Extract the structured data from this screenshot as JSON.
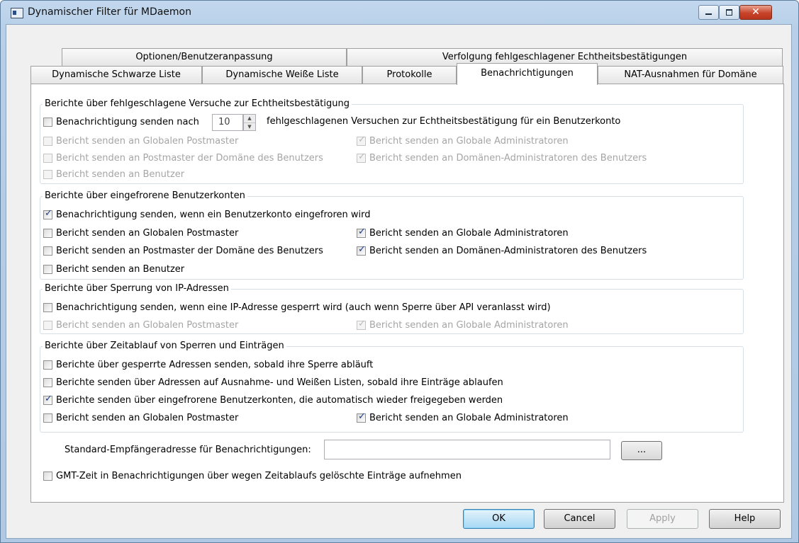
{
  "window": {
    "title": "Dynamischer Filter für MDaemon",
    "close_glyph": "✕"
  },
  "tabs": {
    "row1": [
      "Optionen/Benutzeranpassung",
      "Verfolgung fehlgeschlagener Echtheitsbestätigungen"
    ],
    "row2": [
      "Dynamische Schwarze Liste",
      "Dynamische Weiße Liste",
      "Protokolle",
      "Benachrichtigungen",
      "NAT-Ausnahmen für Domäne"
    ],
    "active": "Benachrichtigungen"
  },
  "groups": {
    "failed_auth": {
      "legend": "Berichte über fehlgeschlagene Versuche zur Echtheitsbestätigung",
      "notify_after_label": "Benachrichtigung senden nach",
      "notify_after_value": "10",
      "notify_after_suffix": "fehlgeschlagenen Versuchen zur Echtheitsbestätigung für ein Benutzerkonto",
      "report_global_postmaster": "Bericht senden an Globalen Postmaster",
      "report_global_admins": "Bericht senden an Globale Administratoren",
      "report_domain_postmaster": "Bericht senden an Postmaster der Domäne des Benutzers",
      "report_domain_admins": "Bericht senden an Domänen-Administratoren des Benutzers",
      "report_user": "Bericht senden an Benutzer"
    },
    "frozen": {
      "legend": "Berichte über eingefrorene Benutzerkonten",
      "notify_label": "Benachrichtigung senden, wenn ein Benutzerkonto eingefroren wird",
      "report_global_postmaster": "Bericht senden an Globalen Postmaster",
      "report_global_admins": "Bericht senden an Globale Administratoren",
      "report_domain_postmaster": "Bericht senden an Postmaster der Domäne des Benutzers",
      "report_domain_admins": "Bericht senden an Domänen-Administratoren des Benutzers",
      "report_user": "Bericht senden an Benutzer"
    },
    "ip_block": {
      "legend": "Berichte über Sperrung von IP-Adressen",
      "notify_label": "Benachrichtigung senden, wenn eine IP-Adresse gesperrt wird (auch wenn Sperre über API veranlasst wird)",
      "report_global_postmaster": "Bericht senden an Globalen Postmaster",
      "report_global_admins": "Bericht senden an Globale Administratoren"
    },
    "expiry": {
      "legend": "Berichte über Zeitablauf von Sperren und Einträgen",
      "blocked_expire": "Berichte über gesperrte Adressen senden, sobald ihre Sperre abläuft",
      "lists_expire": "Berichte senden über Adressen auf Ausnahme- und Weißen Listen, sobald ihre Einträge ablaufen",
      "frozen_released": "Berichte senden über eingefrorene Benutzerkonten, die automatisch wieder freigegeben werden",
      "report_global_postmaster": "Bericht senden an Globalen Postmaster",
      "report_global_admins": "Bericht senden an Globale Administratoren"
    }
  },
  "default_recipient": {
    "label": "Standard-Empfängeradresse für Benachrichtigungen:",
    "value": "",
    "browse_label": "..."
  },
  "gmt_option": "GMT-Zeit in Benachrichtigungen über wegen Zeitablaufs gelöschte Einträge aufnehmen",
  "buttons": {
    "ok": "OK",
    "cancel": "Cancel",
    "apply": "Apply",
    "help": "Help"
  }
}
